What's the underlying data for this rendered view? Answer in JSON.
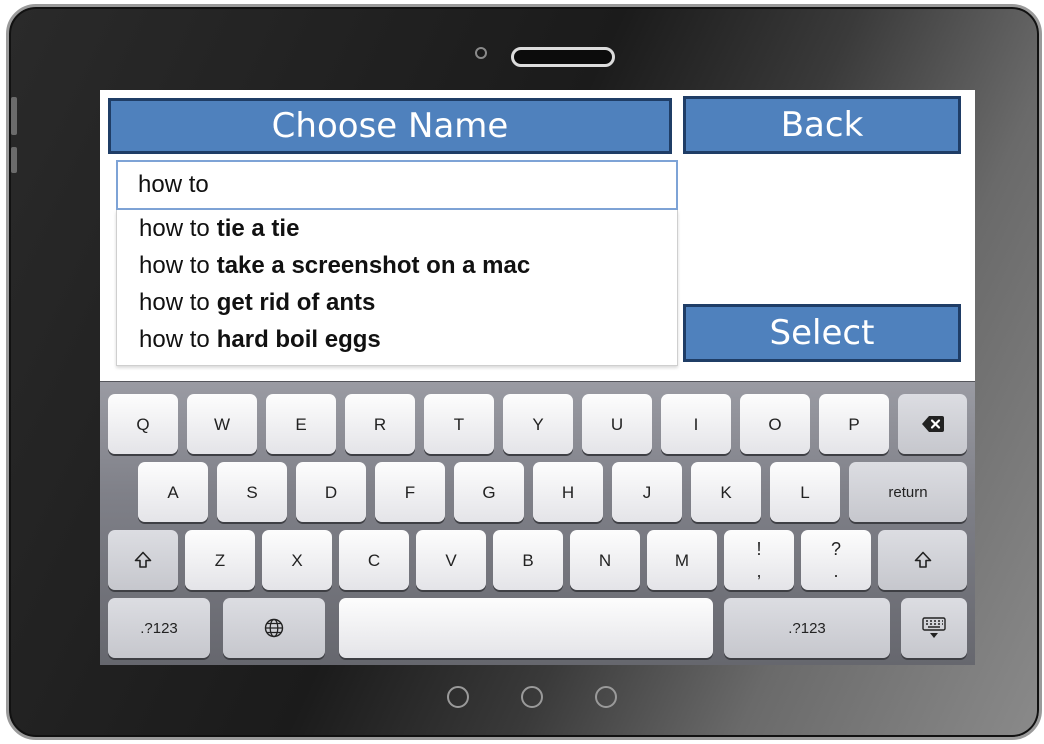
{
  "header": {
    "title": "Choose Name"
  },
  "buttons": {
    "back_label": "Back",
    "select_label": "Select"
  },
  "search": {
    "value": "how to"
  },
  "suggestions": [
    {
      "prefix": "how to",
      "completion": "tie a tie"
    },
    {
      "prefix": "how to",
      "completion": "take a screenshot on a mac"
    },
    {
      "prefix": "how to",
      "completion": "get rid of ants"
    },
    {
      "prefix": "how to",
      "completion": "hard boil eggs"
    }
  ],
  "keyboard": {
    "row1": [
      "Q",
      "W",
      "E",
      "R",
      "T",
      "Y",
      "U",
      "I",
      "O",
      "P"
    ],
    "row2": [
      "A",
      "S",
      "D",
      "F",
      "G",
      "H",
      "J",
      "K",
      "L"
    ],
    "return_label": "return",
    "row3": [
      "Z",
      "X",
      "C",
      "V",
      "B",
      "N",
      "M"
    ],
    "punct1": {
      "top": "!",
      "bottom": ","
    },
    "punct2": {
      "top": "?",
      "bottom": "."
    },
    "numbers_label": ".?123"
  },
  "colors": {
    "button_fill": "#4f81bd",
    "button_border": "#1f3d66",
    "search_border": "#7ea3d6"
  },
  "icons": [
    "backspace-icon",
    "shift-icon",
    "globe-icon",
    "keyboard-dismiss-icon",
    "camera-icon",
    "speaker-icon"
  ]
}
